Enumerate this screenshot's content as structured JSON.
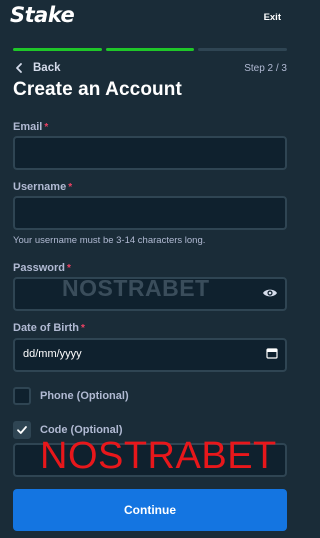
{
  "header": {
    "logo": "Stake",
    "exit_label": "Exit"
  },
  "progress": {
    "steps_total": 3,
    "steps_done": 2
  },
  "nav": {
    "back_label": "Back",
    "step_label": "Step 2 / 3"
  },
  "page": {
    "title": "Create an Account"
  },
  "form": {
    "email_label": "Email",
    "username_label": "Username",
    "username_hint": "Your username must be 3-14 characters long.",
    "password_label": "Password",
    "dob_label": "Date of Birth",
    "dob_placeholder": "dd/mm/yyyy",
    "required_mark": "*",
    "phone_label": "Phone (Optional)",
    "phone_checked": false,
    "code_label": "Code (Optional)",
    "code_checked": true
  },
  "actions": {
    "continue_label": "Continue"
  },
  "watermarks": {
    "red": "NOSTRABET",
    "grey": "NOSTRABET"
  },
  "colors": {
    "background": "#1a2c38",
    "input_bg": "#0f212e",
    "input_border": "#2f4553",
    "progress_done": "#1fc729",
    "primary_button": "#1475e1",
    "required": "#ed4163"
  }
}
